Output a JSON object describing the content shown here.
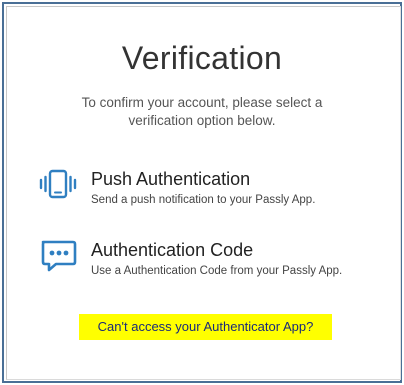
{
  "header": {
    "title": "Verification",
    "subtitle": "To confirm your account, please select a verification option below."
  },
  "options": [
    {
      "icon": "vibrating-phone-icon",
      "title": "Push Authentication",
      "description": "Send a push notification to your Passly App."
    },
    {
      "icon": "message-dots-icon",
      "title": "Authentication Code",
      "description": "Use a Authentication Code from your Passly App."
    }
  ],
  "help_link": {
    "label": "Can't access your Authenticator App?"
  },
  "colors": {
    "icon": "#2f7fc1",
    "highlight": "#ffff00",
    "frame_border": "#4a6f96"
  }
}
